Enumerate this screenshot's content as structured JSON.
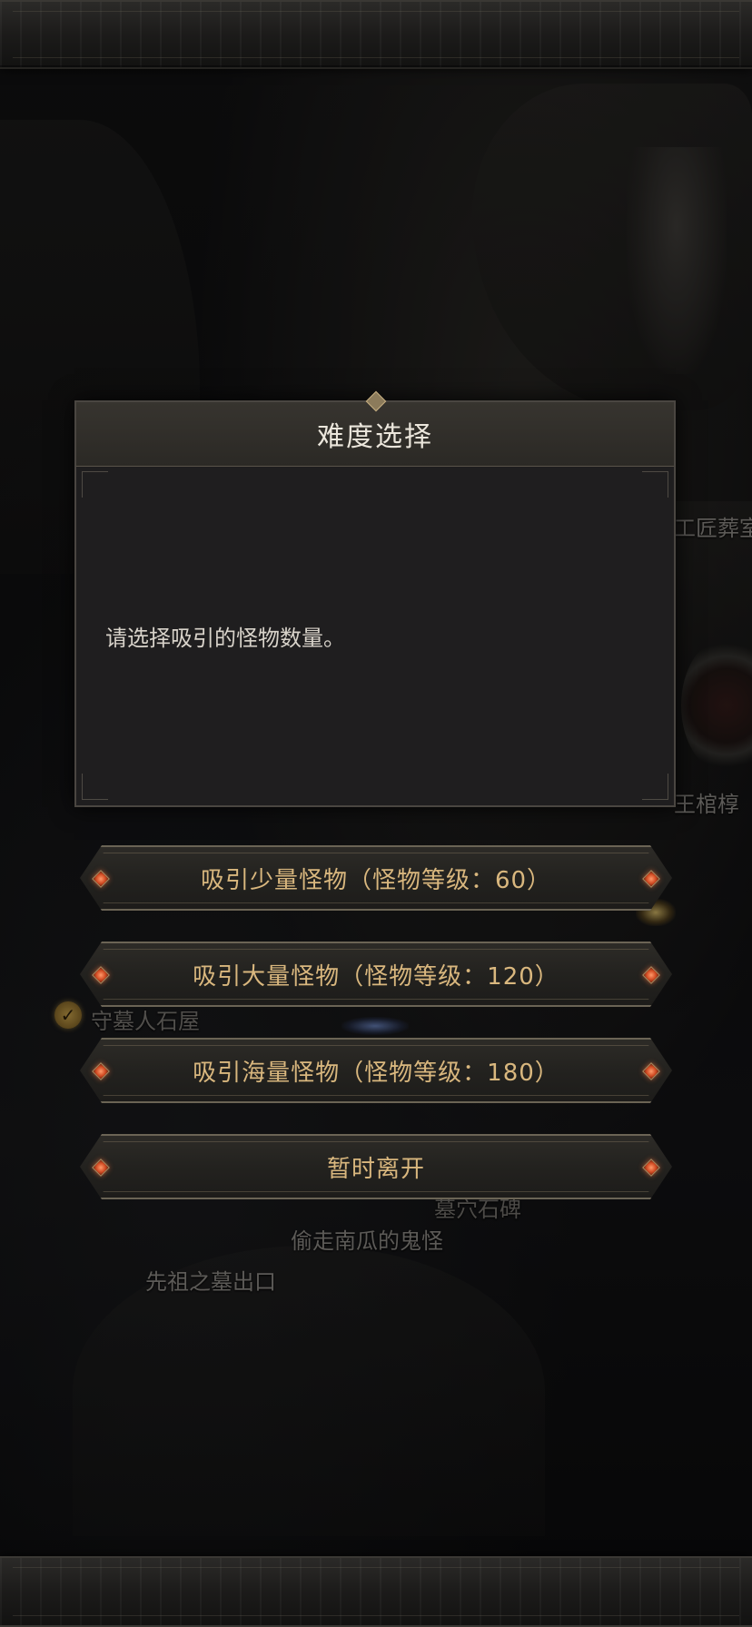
{
  "dialog": {
    "title": "难度选择",
    "message": "请选择吸引的怪物数量。"
  },
  "options": [
    {
      "label": "吸引少量怪物（怪物等级：60）"
    },
    {
      "label": "吸引大量怪物（怪物等级：120）"
    },
    {
      "label": "吸引海量怪物（怪物等级：180）"
    },
    {
      "label": "暂时离开"
    }
  ],
  "map_labels": {
    "craftsman_tomb": "工匠葬室",
    "coffin": "王棺椁",
    "tombkeeper_hut": "守墓人石屋",
    "tombstone": "墓穴石碑",
    "pumpkin_ghost": "偷走南瓜的鬼怪",
    "ancestor_exit": "先祖之墓出口"
  },
  "colors": {
    "option_text": "#d9b77e",
    "dialog_bg": "#1f1e1f",
    "title_text": "#ebe6dc",
    "gem": "#d04a22"
  },
  "icons": {
    "tombkeeper_marker": "checkmark-icon",
    "option_gem": "diamond-gem-icon"
  }
}
